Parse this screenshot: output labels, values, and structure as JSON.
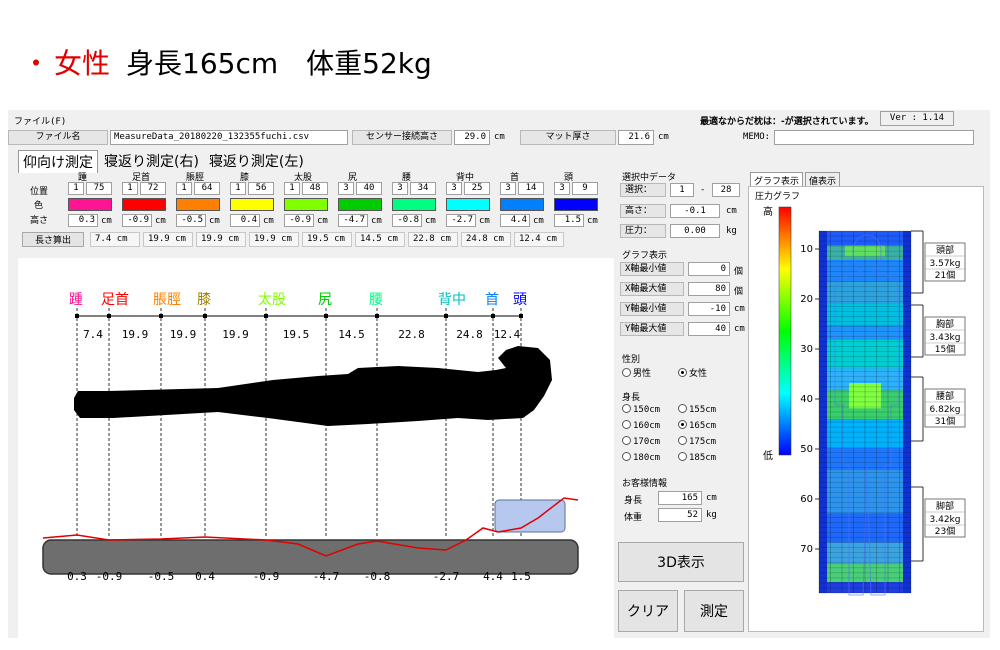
{
  "header": {
    "dot": "・",
    "gender": "女性",
    "rest": "身長165cm　体重52kg"
  },
  "menu": {
    "file": "ファイル(F)",
    "status": "最適なからだ枕は：-が選択されています。",
    "version": "Ver : 1.14"
  },
  "info_bar": {
    "file_label": "ファイル名",
    "file_value": "MeasureData_20180220_132355fuchi.csv",
    "sensor_label": "センサー接続高さ",
    "sensor_value": "29.0",
    "sensor_unit": "cm",
    "mat_label": "マット厚さ",
    "mat_value": "21.6",
    "mat_unit": "cm",
    "memo_label": "MEMO:"
  },
  "tabs": [
    "仰向け測定",
    "寝返り測定(右)",
    "寝返り測定(左)"
  ],
  "row_labels": {
    "position": "位置",
    "color": "色",
    "height": "高さ"
  },
  "parts": [
    {
      "name": "踵",
      "pos1": "1",
      "pos2": "75",
      "color": "#ff1493",
      "height": "0.3",
      "unit": "cm"
    },
    {
      "name": "足首",
      "pos1": "1",
      "pos2": "72",
      "color": "#ff0000",
      "height": "-0.9",
      "unit": "cm"
    },
    {
      "name": "脹脛",
      "pos1": "1",
      "pos2": "64",
      "color": "#ff8000",
      "height": "-0.5",
      "unit": "cm"
    },
    {
      "name": "膝",
      "pos1": "1",
      "pos2": "56",
      "color": "#ffff00",
      "height": "0.4",
      "unit": "cm"
    },
    {
      "name": "太股",
      "pos1": "1",
      "pos2": "48",
      "color": "#80ff00",
      "height": "-0.9",
      "unit": "cm"
    },
    {
      "name": "尻",
      "pos1": "3",
      "pos2": "40",
      "color": "#00cc00",
      "height": "-4.7",
      "unit": "cm"
    },
    {
      "name": "腰",
      "pos1": "3",
      "pos2": "34",
      "color": "#00ff80",
      "height": "-0.8",
      "unit": "cm"
    },
    {
      "name": "背中",
      "pos1": "3",
      "pos2": "25",
      "color": "#00ffff",
      "height": "-2.7",
      "unit": "cm"
    },
    {
      "name": "首",
      "pos1": "3",
      "pos2": "14",
      "color": "#0080ff",
      "height": "4.4",
      "unit": "cm"
    },
    {
      "name": "頭",
      "pos1": "3",
      "pos2": "9",
      "color": "#0000ff",
      "height": "1.5",
      "unit": "cm"
    }
  ],
  "lengths": {
    "button": "長さ算出",
    "unit": "cm",
    "values": [
      "7.4",
      "19.9",
      "19.9",
      "19.9",
      "19.5",
      "14.5",
      "22.8",
      "24.8",
      "12.4"
    ]
  },
  "body_diagram": {
    "labels": [
      "踵",
      "足首",
      "脹脛",
      "膝",
      "太股",
      "尻",
      "腰",
      "背中",
      "首",
      "頭"
    ],
    "segment_values": [
      "7.4",
      "19.9",
      "19.9",
      "19.9",
      "19.5",
      "14.5",
      "22.8",
      "24.8",
      "12.4"
    ],
    "bottom_values": [
      "0.3",
      "-0.9",
      "-0.5",
      "0.4",
      "-0.9",
      "-4.7",
      "-0.8",
      "-2.7",
      "4.4",
      "1.5"
    ]
  },
  "selected_data": {
    "title": "選択中データ",
    "select_label": "選択：",
    "select_from": "1",
    "select_dash": "-",
    "select_to": "28",
    "height_label": "高さ：",
    "height_value": "-0.1",
    "height_unit": "cm",
    "pressure_label": "圧力：",
    "pressure_value": "0.00",
    "pressure_unit": "kg"
  },
  "graph_settings": {
    "title": "グラフ表示",
    "xmin_label": "X軸最小値",
    "xmin_value": "0",
    "xmin_unit": "個",
    "xmax_label": "X軸最大値",
    "xmax_value": "80",
    "xmax_unit": "個",
    "ymin_label": "Y軸最小値",
    "ymin_value": "-10",
    "ymin_unit": "cm",
    "ymax_label": "Y軸最大値",
    "ymax_value": "40",
    "ymax_unit": "cm"
  },
  "gender": {
    "title": "性別",
    "options": [
      "男性",
      "女性"
    ],
    "selected": 1
  },
  "height_select": {
    "title": "身長",
    "options": [
      "150cm",
      "155cm",
      "160cm",
      "165cm",
      "170cm",
      "175cm",
      "180cm",
      "185cm"
    ],
    "selected": 3
  },
  "customer": {
    "title": "お客様情報",
    "height_label": "身長",
    "height_value": "165",
    "height_unit": "cm",
    "weight_label": "体重",
    "weight_value": "52",
    "weight_unit": "kg"
  },
  "buttons": {
    "view3d": "3D表示",
    "clear": "クリア",
    "measure": "測定"
  },
  "right_tabs": [
    "グラフ表示",
    "値表示"
  ],
  "pressure_graph": {
    "title": "圧力グラフ",
    "legend_high": "高",
    "legend_low": "低",
    "y_ticks": [
      "10",
      "20",
      "30",
      "40",
      "50",
      "60",
      "70"
    ],
    "regions": [
      {
        "name": "頭部",
        "weight": "3.57kg",
        "count": "21個"
      },
      {
        "name": "胸部",
        "weight": "3.43kg",
        "count": "15個"
      },
      {
        "name": "腰部",
        "weight": "6.82kg",
        "count": "31個"
      },
      {
        "name": "脚部",
        "weight": "3.42kg",
        "count": "23個"
      }
    ]
  }
}
